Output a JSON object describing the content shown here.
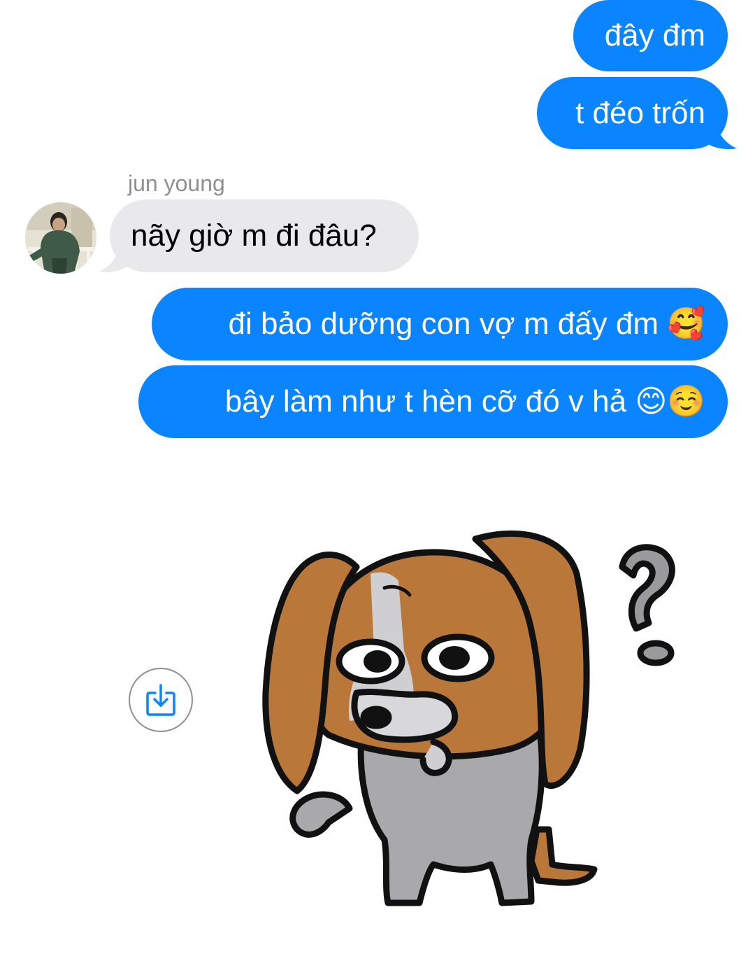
{
  "messages": [
    {
      "direction": "outgoing",
      "text": "đây đm"
    },
    {
      "direction": "outgoing",
      "text": "t đéo trốn"
    },
    {
      "direction": "incoming",
      "sender": "jun young",
      "text": "nãy giờ m đi đâu?"
    },
    {
      "direction": "outgoing",
      "text": "đi bảo dưỡng con vợ m đấy đm 🥰"
    },
    {
      "direction": "outgoing",
      "text": "bây làm như t hèn cỡ đó v hả 😊☺️"
    }
  ],
  "sticker": {
    "icon": "confused-puppy-sticker"
  },
  "actions": {
    "save_icon": "download-icon"
  },
  "colors": {
    "outgoing_bubble": "#0a84ff",
    "incoming_bubble": "#e9e9eb",
    "sender_name": "#8e8e93"
  }
}
